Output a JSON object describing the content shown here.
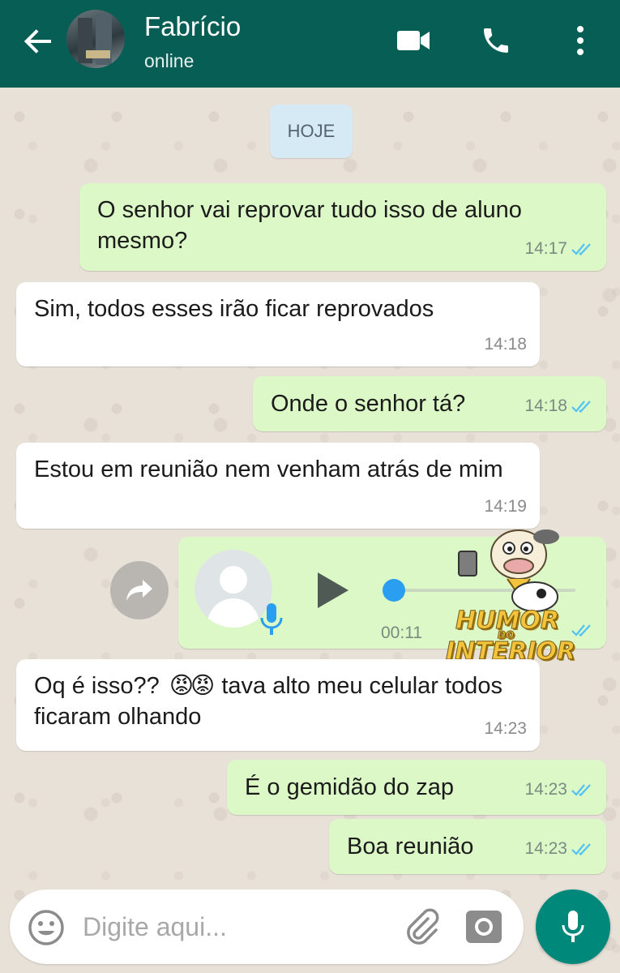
{
  "header": {
    "contact_name": "Fabrício",
    "status": "online",
    "icons": [
      "back-arrow-icon",
      "video-call-icon",
      "phone-icon",
      "more-vert-icon"
    ],
    "color": "#075e54"
  },
  "date_chip": "HOJE",
  "messages": [
    {
      "direction": "out",
      "text": "O senhor vai reprovar tudo isso de aluno mesmo?",
      "time": "14:17",
      "read": true
    },
    {
      "direction": "in",
      "text": "Sim, todos esses irão ficar reprovados",
      "time": "14:18"
    },
    {
      "direction": "out",
      "text": "Onde o senhor tá?",
      "time": "14:18",
      "read": true
    },
    {
      "direction": "in",
      "text": "Estou em reunião nem venham atrás de mim",
      "time": "14:19"
    },
    {
      "direction": "out",
      "type": "voice",
      "duration": "00:11",
      "progress": 0,
      "time": "14:19",
      "read": true
    },
    {
      "direction": "in",
      "text_before": "Oq é isso??",
      "emoji": "😡😡",
      "text_after": "tava alto meu celular todos ficaram olhando",
      "time": "14:23"
    },
    {
      "direction": "out",
      "text": "É o gemidão do zap",
      "time": "14:23",
      "read": true
    },
    {
      "direction": "out",
      "text": "Boa reunião",
      "time": "14:23",
      "read": true
    }
  ],
  "watermark": {
    "line1": "HUMOR",
    "line2": "DO",
    "line3": "INTERIOR"
  },
  "input": {
    "placeholder": "Digite aqui...",
    "icons": [
      "emoji-icon",
      "attach-icon",
      "camera-icon",
      "mic-icon"
    ]
  },
  "colors": {
    "outgoing_bubble": "#dcf8c6",
    "incoming_bubble": "#ffffff",
    "read_ticks": "#4fc3f7",
    "send_button": "#00897b"
  }
}
